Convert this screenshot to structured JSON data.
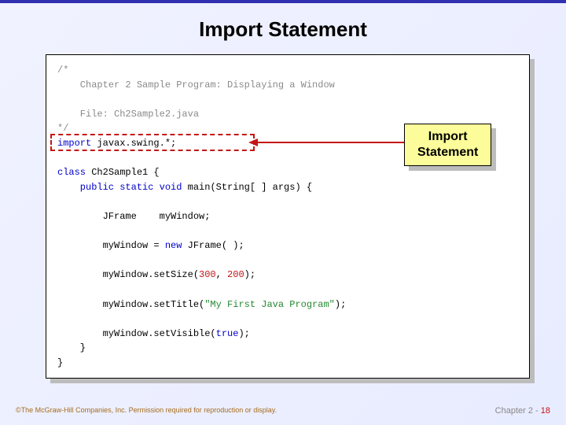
{
  "title": "Import Statement",
  "code": {
    "open_comment": "/*",
    "comment_line1": "    Chapter 2 Sample Program: Displaying a Window",
    "comment_blank": "",
    "comment_line2": "    File: Ch2Sample2.java",
    "close_comment": "*/",
    "import_kw": "import",
    "import_rest": " javax.swing.*;",
    "class_kw": "class",
    "class_rest": " Ch2Sample1 {",
    "psv1": "    public static void",
    "psv2": " main(String[ ] args) {",
    "l1a": "        JFrame    myWindow;",
    "l2a": "        myWindow = ",
    "l2b": "new",
    "l2c": " JFrame( );",
    "l3a": "        myWindow.setSize(",
    "l3b": "300",
    "l3c": ", ",
    "l3d": "200",
    "l3e": ");",
    "l4a": "        myWindow.setTitle(",
    "l4b": "\"My First Java Program\"",
    "l4c": ");",
    "l5a": "        myWindow.setVisible(",
    "l5b": "true",
    "l5c": ");",
    "close_inner": "    }",
    "close_outer": "}"
  },
  "callout": {
    "line1": "Import",
    "line2": "Statement"
  },
  "footer": {
    "copyright": "©The McGraw-Hill Companies, Inc. Permission required for reproduction or display.",
    "chapter": "Chapter 2",
    "sep": " - ",
    "page": "18"
  }
}
